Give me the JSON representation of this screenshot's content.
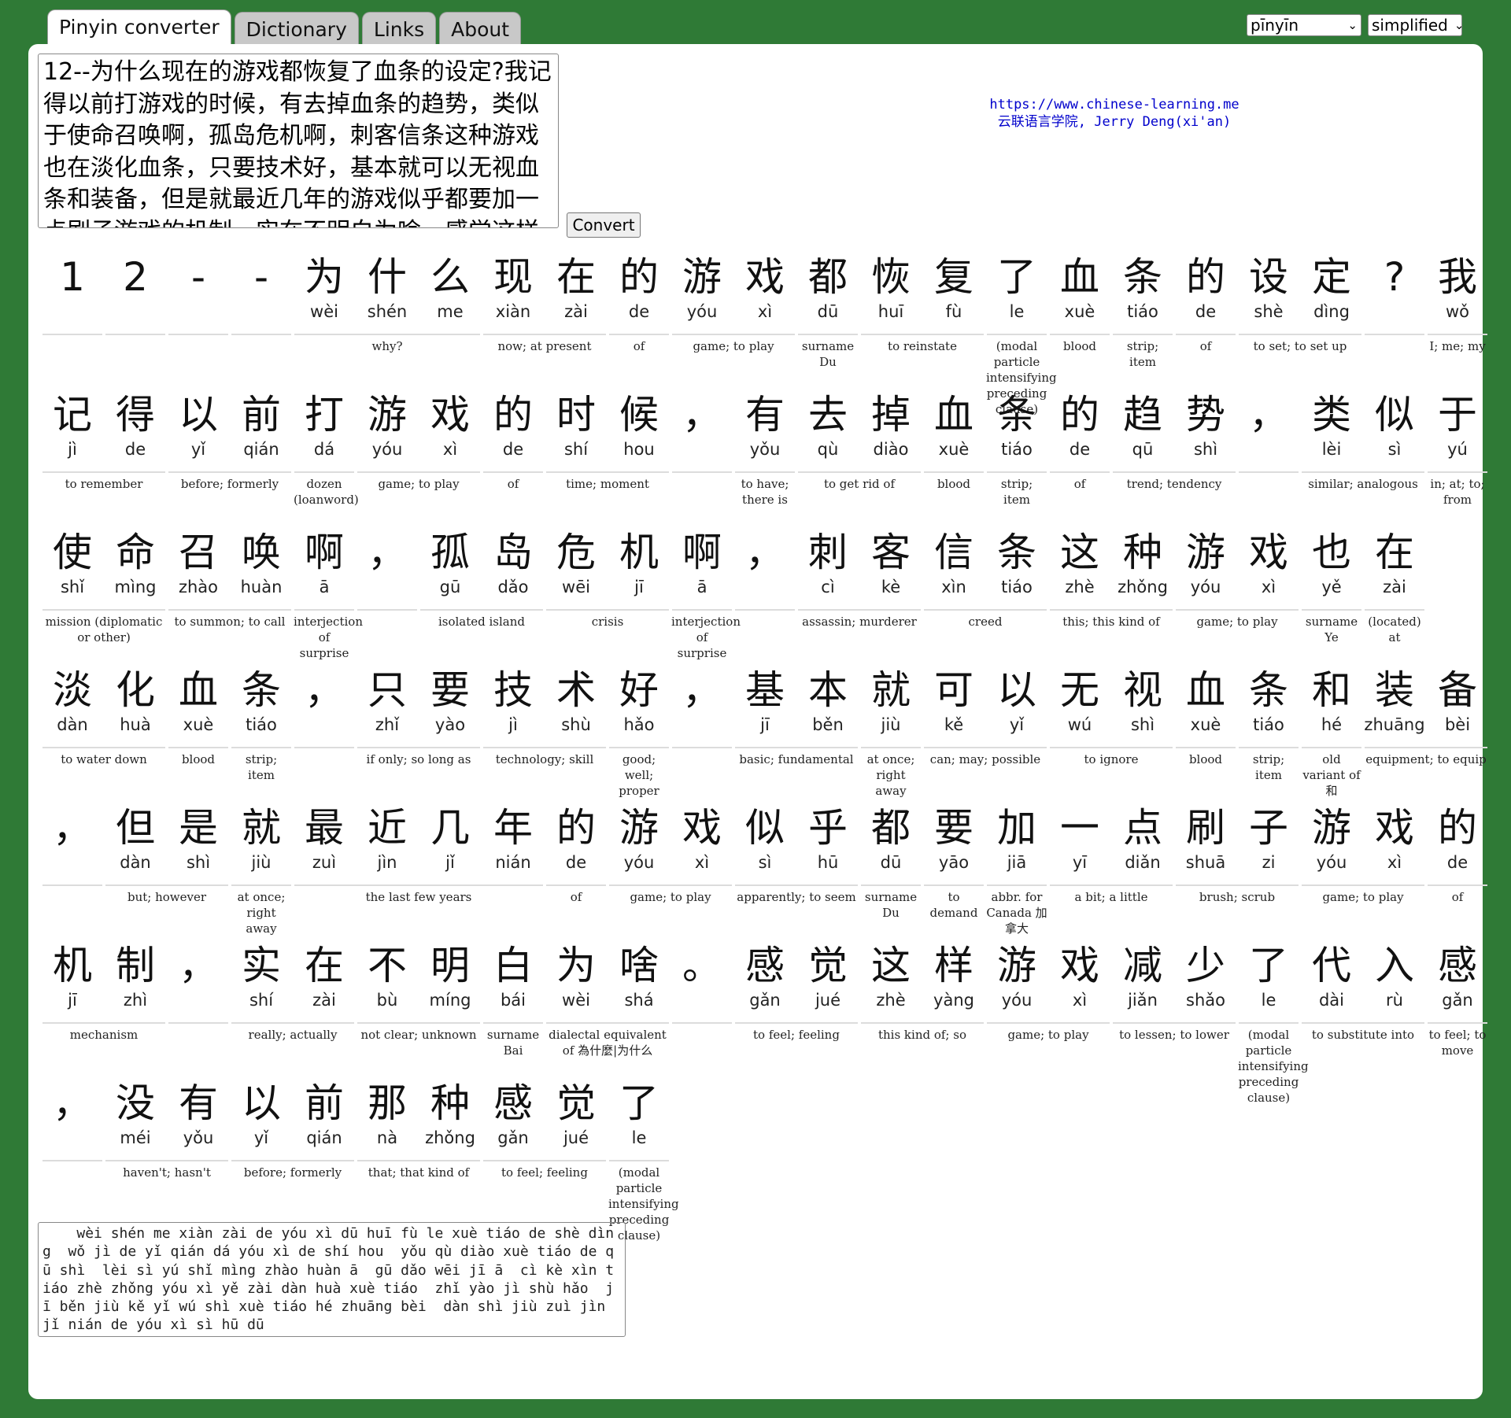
{
  "tabs": [
    "Pinyin converter",
    "Dictionary",
    "Links",
    "About"
  ],
  "settings": {
    "tone_mode": "pīnyīn",
    "script": "simplified"
  },
  "input_text": "12--为什么现在的游戏都恢复了血条的设定?我记得以前打游戏的时候，有去掉血条的趋势，类似于使命召唤啊，孤岛危机啊，刺客信条这种游戏也在淡化血条，只要技术好，基本就可以无视血条和装备，但是就最近几年的游戏似乎都要加一点刷子游戏的机制，实在不明白为啥，感觉这样游戏减少了代入感",
  "convert_label": "Convert",
  "credit": {
    "url": "https://www.chinese-learning.me",
    "author": "云联语言学院, Jerry Deng(xi'an)"
  },
  "rows": [
    {
      "chars": [
        [
          "1",
          ""
        ],
        [
          "2",
          ""
        ],
        [
          "-",
          ""
        ],
        [
          "-",
          ""
        ],
        [
          "为",
          "wèi"
        ],
        [
          "什",
          "shén"
        ],
        [
          "么",
          "me"
        ],
        [
          "现",
          "xiàn"
        ],
        [
          "在",
          "zài"
        ],
        [
          "的",
          "de"
        ],
        [
          "游",
          "yóu"
        ],
        [
          "戏",
          "xì"
        ],
        [
          "都",
          "dū"
        ],
        [
          "恢",
          "huī"
        ],
        [
          "复",
          "fù"
        ],
        [
          "了",
          "le"
        ],
        [
          "血",
          "xuè"
        ],
        [
          "条",
          "tiáo"
        ],
        [
          "的",
          "de"
        ],
        [
          "设",
          "shè"
        ],
        [
          "定",
          "dìng"
        ],
        [
          "?",
          ""
        ],
        [
          "我",
          "wǒ"
        ]
      ],
      "groups": [
        [
          0,
          1,
          ""
        ],
        [
          1,
          1,
          ""
        ],
        [
          2,
          1,
          ""
        ],
        [
          3,
          1,
          ""
        ],
        [
          4,
          3,
          "why?"
        ],
        [
          7,
          2,
          "now; at present"
        ],
        [
          9,
          1,
          "of"
        ],
        [
          10,
          2,
          "game; to play"
        ],
        [
          12,
          1,
          "surname Du"
        ],
        [
          13,
          2,
          "to reinstate"
        ],
        [
          15,
          1,
          "(modal particle intensifying preceding clause)"
        ],
        [
          16,
          1,
          "blood"
        ],
        [
          17,
          1,
          "strip; item"
        ],
        [
          18,
          1,
          "of"
        ],
        [
          19,
          2,
          "to set; to set up"
        ],
        [
          21,
          1,
          ""
        ],
        [
          22,
          1,
          "I; me; my"
        ]
      ]
    },
    {
      "chars": [
        [
          "记",
          "jì"
        ],
        [
          "得",
          "de"
        ],
        [
          "以",
          "yǐ"
        ],
        [
          "前",
          "qián"
        ],
        [
          "打",
          "dá"
        ],
        [
          "游",
          "yóu"
        ],
        [
          "戏",
          "xì"
        ],
        [
          "的",
          "de"
        ],
        [
          "时",
          "shí"
        ],
        [
          "候",
          "hou"
        ],
        [
          "，",
          ""
        ],
        [
          "有",
          "yǒu"
        ],
        [
          "去",
          "qù"
        ],
        [
          "掉",
          "diào"
        ],
        [
          "血",
          "xuè"
        ],
        [
          "条",
          "tiáo"
        ],
        [
          "的",
          "de"
        ],
        [
          "趋",
          "qū"
        ],
        [
          "势",
          "shì"
        ],
        [
          "，",
          ""
        ],
        [
          "类",
          "lèi"
        ],
        [
          "似",
          "sì"
        ],
        [
          "于",
          "yú"
        ]
      ],
      "groups": [
        [
          0,
          2,
          "to remember"
        ],
        [
          2,
          2,
          "before; formerly"
        ],
        [
          4,
          1,
          "dozen (loanword)"
        ],
        [
          5,
          2,
          "game; to play"
        ],
        [
          7,
          1,
          "of"
        ],
        [
          8,
          2,
          "time; moment"
        ],
        [
          10,
          1,
          ""
        ],
        [
          11,
          1,
          "to have; there is"
        ],
        [
          12,
          2,
          "to get rid of"
        ],
        [
          14,
          1,
          "blood"
        ],
        [
          15,
          1,
          "strip; item"
        ],
        [
          16,
          1,
          "of"
        ],
        [
          17,
          2,
          "trend; tendency"
        ],
        [
          19,
          1,
          ""
        ],
        [
          20,
          2,
          "similar; analogous"
        ],
        [
          22,
          1,
          "in; at; to; from"
        ]
      ]
    },
    {
      "chars": [
        [
          "使",
          "shǐ"
        ],
        [
          "命",
          "mìng"
        ],
        [
          "召",
          "zhào"
        ],
        [
          "唤",
          "huàn"
        ],
        [
          "啊",
          "ā"
        ],
        [
          "，",
          ""
        ],
        [
          "孤",
          "gū"
        ],
        [
          "岛",
          "dǎo"
        ],
        [
          "危",
          "wēi"
        ],
        [
          "机",
          "jī"
        ],
        [
          "啊",
          "ā"
        ],
        [
          "，",
          ""
        ],
        [
          "刺",
          "cì"
        ],
        [
          "客",
          "kè"
        ],
        [
          "信",
          "xìn"
        ],
        [
          "条",
          "tiáo"
        ],
        [
          "这",
          "zhè"
        ],
        [
          "种",
          "zhǒng"
        ],
        [
          "游",
          "yóu"
        ],
        [
          "戏",
          "xì"
        ],
        [
          "也",
          "yě"
        ],
        [
          "在",
          "zài"
        ]
      ],
      "groups": [
        [
          0,
          2,
          "mission (diplomatic or other)"
        ],
        [
          2,
          2,
          "to summon; to call"
        ],
        [
          4,
          1,
          "interjection of surprise"
        ],
        [
          5,
          1,
          ""
        ],
        [
          6,
          2,
          "isolated island"
        ],
        [
          8,
          2,
          "crisis"
        ],
        [
          10,
          1,
          "interjection of surprise"
        ],
        [
          11,
          1,
          ""
        ],
        [
          12,
          2,
          "assassin; murderer"
        ],
        [
          14,
          2,
          "creed"
        ],
        [
          16,
          2,
          "this; this kind of"
        ],
        [
          18,
          2,
          "game; to play"
        ],
        [
          20,
          1,
          "surname Ye"
        ],
        [
          21,
          1,
          "(located) at"
        ]
      ]
    },
    {
      "chars": [
        [
          "淡",
          "dàn"
        ],
        [
          "化",
          "huà"
        ],
        [
          "血",
          "xuè"
        ],
        [
          "条",
          "tiáo"
        ],
        [
          "，",
          ""
        ],
        [
          "只",
          "zhǐ"
        ],
        [
          "要",
          "yào"
        ],
        [
          "技",
          "jì"
        ],
        [
          "术",
          "shù"
        ],
        [
          "好",
          "hǎo"
        ],
        [
          "，",
          ""
        ],
        [
          "基",
          "jī"
        ],
        [
          "本",
          "běn"
        ],
        [
          "就",
          "jiù"
        ],
        [
          "可",
          "kě"
        ],
        [
          "以",
          "yǐ"
        ],
        [
          "无",
          "wú"
        ],
        [
          "视",
          "shì"
        ],
        [
          "血",
          "xuè"
        ],
        [
          "条",
          "tiáo"
        ],
        [
          "和",
          "hé"
        ],
        [
          "装",
          "zhuāng"
        ],
        [
          "备",
          "bèi"
        ]
      ],
      "groups": [
        [
          0,
          2,
          "to water down"
        ],
        [
          2,
          1,
          "blood"
        ],
        [
          3,
          1,
          "strip; item"
        ],
        [
          4,
          1,
          ""
        ],
        [
          5,
          2,
          "if only; so long as"
        ],
        [
          7,
          2,
          "technology; skill"
        ],
        [
          9,
          1,
          "good; well; proper"
        ],
        [
          10,
          1,
          ""
        ],
        [
          11,
          2,
          "basic; fundamental"
        ],
        [
          13,
          1,
          "at once; right away"
        ],
        [
          14,
          2,
          "can; may; possible"
        ],
        [
          16,
          2,
          "to ignore"
        ],
        [
          18,
          1,
          "blood"
        ],
        [
          19,
          1,
          "strip; item"
        ],
        [
          20,
          1,
          "old variant of 和"
        ],
        [
          21,
          2,
          "equipment; to equip"
        ]
      ]
    },
    {
      "chars": [
        [
          "，",
          ""
        ],
        [
          "但",
          "dàn"
        ],
        [
          "是",
          "shì"
        ],
        [
          "就",
          "jiù"
        ],
        [
          "最",
          "zuì"
        ],
        [
          "近",
          "jìn"
        ],
        [
          "几",
          "jǐ"
        ],
        [
          "年",
          "nián"
        ],
        [
          "的",
          "de"
        ],
        [
          "游",
          "yóu"
        ],
        [
          "戏",
          "xì"
        ],
        [
          "似",
          "sì"
        ],
        [
          "乎",
          "hū"
        ],
        [
          "都",
          "dū"
        ],
        [
          "要",
          "yāo"
        ],
        [
          "加",
          "jiā"
        ],
        [
          "一",
          "yī"
        ],
        [
          "点",
          "diǎn"
        ],
        [
          "刷",
          "shuā"
        ],
        [
          "子",
          "zi"
        ],
        [
          "游",
          "yóu"
        ],
        [
          "戏",
          "xì"
        ],
        [
          "的",
          "de"
        ]
      ],
      "groups": [
        [
          0,
          1,
          ""
        ],
        [
          1,
          2,
          "but; however"
        ],
        [
          3,
          1,
          "at once; right away"
        ],
        [
          4,
          4,
          "the last few years"
        ],
        [
          8,
          1,
          "of"
        ],
        [
          9,
          2,
          "game; to play"
        ],
        [
          11,
          2,
          "apparently; to seem"
        ],
        [
          13,
          1,
          "surname Du"
        ],
        [
          14,
          1,
          "to demand"
        ],
        [
          15,
          1,
          "abbr. for Canada 加拿大"
        ],
        [
          16,
          2,
          "a bit; a little"
        ],
        [
          18,
          2,
          "brush; scrub"
        ],
        [
          20,
          2,
          "game; to play"
        ],
        [
          22,
          1,
          "of"
        ]
      ]
    },
    {
      "chars": [
        [
          "机",
          "jī"
        ],
        [
          "制",
          "zhì"
        ],
        [
          "，",
          ""
        ],
        [
          "实",
          "shí"
        ],
        [
          "在",
          "zài"
        ],
        [
          "不",
          "bù"
        ],
        [
          "明",
          "míng"
        ],
        [
          "白",
          "bái"
        ],
        [
          "为",
          "wèi"
        ],
        [
          "啥",
          "shá"
        ],
        [
          "。",
          ""
        ],
        [
          "感",
          "gǎn"
        ],
        [
          "觉",
          "jué"
        ],
        [
          "这",
          "zhè"
        ],
        [
          "样",
          "yàng"
        ],
        [
          "游",
          "yóu"
        ],
        [
          "戏",
          "xì"
        ],
        [
          "减",
          "jiǎn"
        ],
        [
          "少",
          "shǎo"
        ],
        [
          "了",
          "le"
        ],
        [
          "代",
          "dài"
        ],
        [
          "入",
          "rù"
        ],
        [
          "感",
          "gǎn"
        ]
      ],
      "groups": [
        [
          0,
          2,
          "mechanism"
        ],
        [
          2,
          1,
          ""
        ],
        [
          3,
          2,
          "really; actually"
        ],
        [
          5,
          2,
          "not clear; unknown"
        ],
        [
          7,
          1,
          "surname Bai"
        ],
        [
          8,
          2,
          "dialectal equivalent of 為什麼|为什么"
        ],
        [
          10,
          1,
          ""
        ],
        [
          11,
          2,
          "to feel; feeling"
        ],
        [
          13,
          2,
          "this kind of; so"
        ],
        [
          15,
          2,
          "game; to play"
        ],
        [
          17,
          2,
          "to lessen; to lower"
        ],
        [
          19,
          1,
          "(modal particle intensifying preceding clause)"
        ],
        [
          20,
          2,
          "to substitute into"
        ],
        [
          22,
          1,
          "to feel; to move"
        ]
      ]
    },
    {
      "chars": [
        [
          "，",
          ""
        ],
        [
          "没",
          "méi"
        ],
        [
          "有",
          "yǒu"
        ],
        [
          "以",
          "yǐ"
        ],
        [
          "前",
          "qián"
        ],
        [
          "那",
          "nà"
        ],
        [
          "种",
          "zhǒng"
        ],
        [
          "感",
          "gǎn"
        ],
        [
          "觉",
          "jué"
        ],
        [
          "了",
          "le"
        ]
      ],
      "groups": [
        [
          0,
          1,
          ""
        ],
        [
          1,
          2,
          "haven't; hasn't"
        ],
        [
          3,
          2,
          "before; formerly"
        ],
        [
          5,
          2,
          "that; that kind of"
        ],
        [
          7,
          2,
          "to feel; feeling"
        ],
        [
          9,
          1,
          "(modal particle intensifying preceding clause)"
        ]
      ]
    }
  ],
  "output_text": "    wèi shén me xiàn zài de yóu xì dū huī fù le xuè tiáo de shè dìng  wǒ jì de yǐ qián dá yóu xì de shí hou  yǒu qù diào xuè tiáo de qū shì  lèi sì yú shǐ mìng zhào huàn ā  gū dǎo wēi jī ā  cì kè xìn tiáo zhè zhǒng yóu xì yě zài dàn huà xuè tiáo  zhǐ yào jì shù hǎo  jī běn jiù kě yǐ wú shì xuè tiáo hé zhuāng bèi  dàn shì jiù zuì jìn jǐ nián de yóu xì sì hū dū"
}
